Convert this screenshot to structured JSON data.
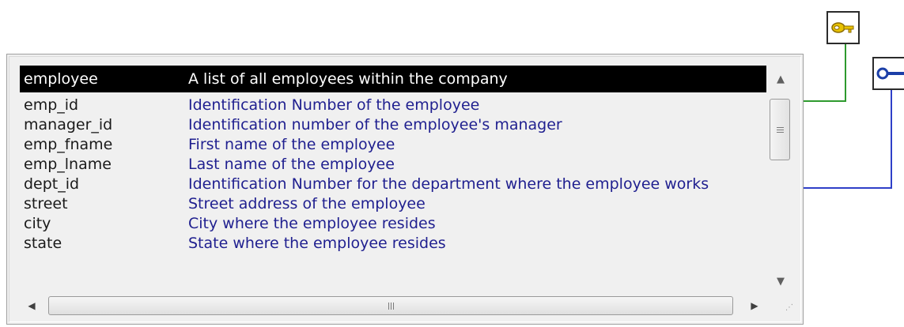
{
  "table": {
    "header": {
      "name": "employee",
      "description": "A list of all employees within the company"
    },
    "columns": [
      {
        "name": "emp_id",
        "description": "Identification Number of the employee"
      },
      {
        "name": "manager_id",
        "description": "Identification number of the employee's manager"
      },
      {
        "name": "emp_fname",
        "description": "First name of the employee"
      },
      {
        "name": "emp_lname",
        "description": "Last name of the employee"
      },
      {
        "name": "dept_id",
        "description": "Identification Number for the department where the employee works"
      },
      {
        "name": "street",
        "description": "Street address of the employee"
      },
      {
        "name": "city",
        "description": "City where the employee resides"
      },
      {
        "name": "state",
        "description": "State where the employee resides"
      }
    ]
  },
  "scrollbar": {
    "vertical_grip": "≡",
    "horizontal_grip": "III"
  },
  "icons": {
    "primary_key": "primary-key-icon",
    "foreign_key": "foreign-key-icon"
  },
  "colors": {
    "header_bg": "#000000",
    "header_text": "#ffffff",
    "column_name": "#1a1a1a",
    "column_description": "#1f1f8f",
    "primary_key_line": "#2e9a2e",
    "foreign_key_line": "#2f3fc8",
    "key_gold": "#d9a800"
  }
}
